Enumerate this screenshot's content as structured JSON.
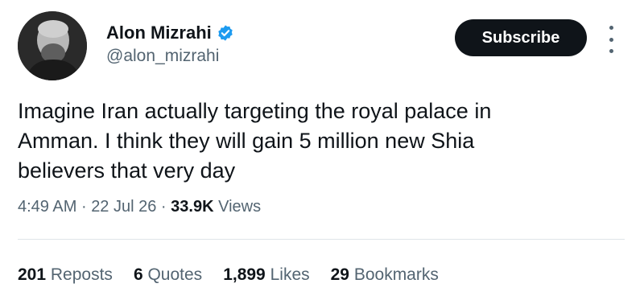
{
  "author": {
    "name": "Alon Mizrahi",
    "handle": "@alon_mizrahi",
    "verified": true
  },
  "actions": {
    "subscribe_label": "Subscribe",
    "more_icon": "more-vertical-icon"
  },
  "tweet": {
    "lines": [
      "Imagine Iran actually targeting the royal palace in",
      "Amman. I think they will gain 5 million new Shia",
      "believers that very day"
    ],
    "time": "4:49 AM",
    "date": "22 Jul 26",
    "views_count": "33.9K",
    "views_label": "Views",
    "separator": "·"
  },
  "stats": [
    {
      "count": "201",
      "label": "Reposts"
    },
    {
      "count": "6",
      "label": "Quotes"
    },
    {
      "count": "1,899",
      "label": "Likes"
    },
    {
      "count": "29",
      "label": "Bookmarks"
    }
  ],
  "colors": {
    "verified_blue": "#1d9bf0",
    "text_primary": "#0f1419",
    "text_secondary": "#536471",
    "button_bg": "#0f1419"
  }
}
